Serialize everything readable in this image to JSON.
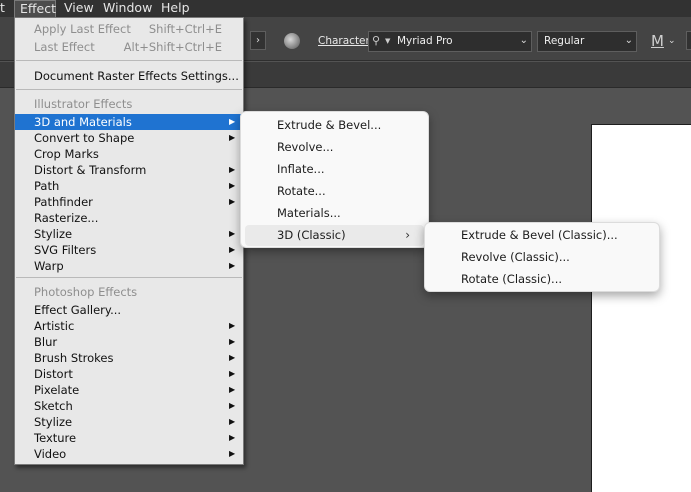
{
  "menubar": {
    "items": [
      {
        "label": "t"
      },
      {
        "label": "Effect"
      },
      {
        "label": "View"
      },
      {
        "label": "Window"
      },
      {
        "label": "Help"
      }
    ]
  },
  "controlbar": {
    "character_label": "Character:",
    "font_family": "Myriad Pro",
    "font_style": "Regular",
    "size_icon": "M"
  },
  "effect_menu": {
    "apply_last_label": "Apply Last Effect",
    "apply_last_shortcut": "Shift+Ctrl+E",
    "last_effect_label": "Last Effect",
    "last_effect_shortcut": "Alt+Shift+Ctrl+E",
    "document_raster_settings": "Document Raster Effects Settings...",
    "illustrator_section": "Illustrator Effects",
    "illustrator_items": [
      "3D and Materials",
      "Convert to Shape",
      "Crop Marks",
      "Distort & Transform",
      "Path",
      "Pathfinder",
      "Rasterize...",
      "Stylize",
      "SVG Filters",
      "Warp"
    ],
    "photoshop_section": "Photoshop Effects",
    "photoshop_items": [
      "Effect Gallery...",
      "Artistic",
      "Blur",
      "Brush Strokes",
      "Distort",
      "Pixelate",
      "Sketch",
      "Stylize",
      "Texture",
      "Video"
    ]
  },
  "submenu_3d": {
    "items": [
      "Extrude & Bevel...",
      "Revolve...",
      "Inflate...",
      "Rotate...",
      "Materials...",
      "3D (Classic)"
    ]
  },
  "submenu_3d_classic": {
    "items": [
      "Extrude & Bevel (Classic)...",
      "Revolve (Classic)...",
      "Rotate (Classic)..."
    ]
  },
  "colors": {
    "menu_bg": "#e8e8e8",
    "highlight": "#1f73d1",
    "app_chrome": "#323232",
    "canvas": "#535353"
  }
}
